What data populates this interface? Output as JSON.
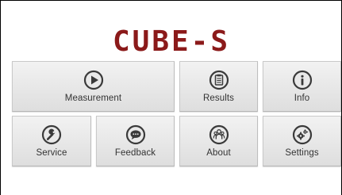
{
  "logo": {
    "text": "CUBE-S",
    "color": "#8b1a1a"
  },
  "tiles": [
    {
      "label": "Measurement",
      "icon": "play-icon"
    },
    {
      "label": "Results",
      "icon": "clipboard-icon"
    },
    {
      "label": "Info",
      "icon": "info-icon"
    },
    {
      "label": "Service",
      "icon": "wrench-icon"
    },
    {
      "label": "Feedback",
      "icon": "chat-bubble-icon"
    },
    {
      "label": "About",
      "icon": "people-icon"
    },
    {
      "label": "Settings",
      "icon": "gears-icon"
    }
  ],
  "colors": {
    "icon_ring": "#3a3a3a",
    "icon_fill": "#e9e9e9",
    "label": "#333333"
  }
}
